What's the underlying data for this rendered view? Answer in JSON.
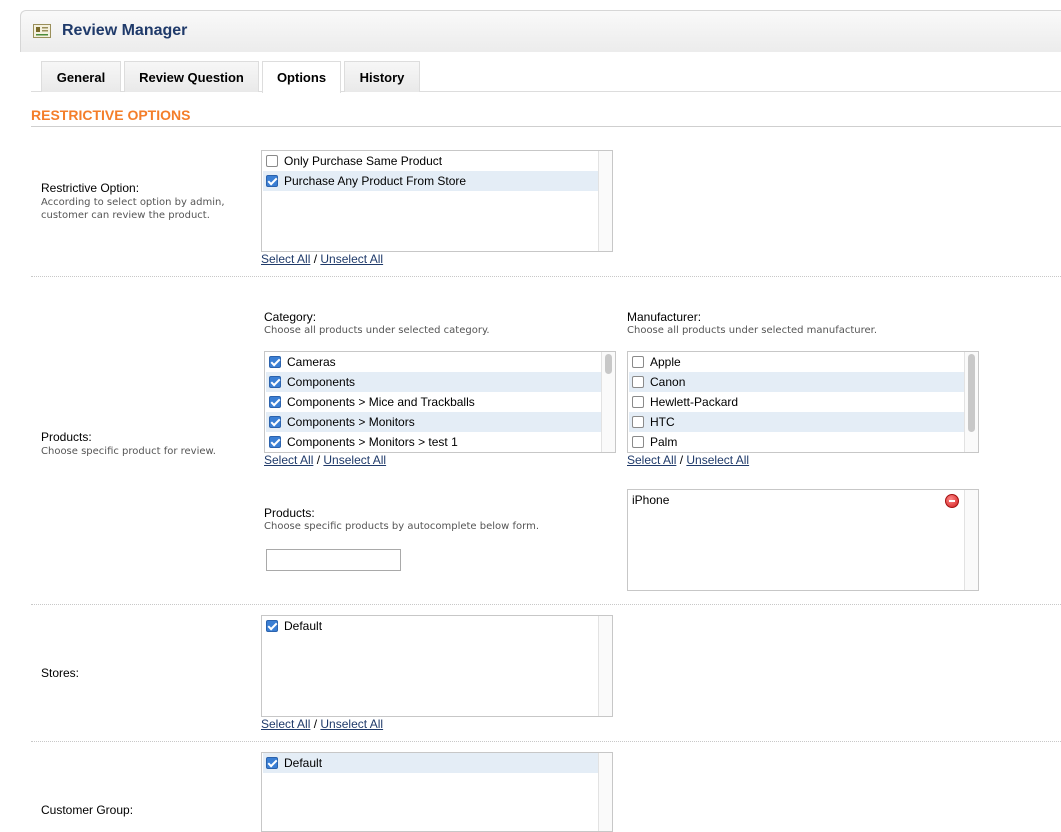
{
  "header": {
    "title": "Review Manager",
    "icon": "module-icon"
  },
  "tabs": [
    {
      "label": "General",
      "active": false
    },
    {
      "label": "Review Question",
      "active": false
    },
    {
      "label": "Options",
      "active": true
    },
    {
      "label": "History",
      "active": false
    }
  ],
  "section_title": "RESTRICTIVE OPTIONS",
  "restrictive": {
    "label": "Restrictive Option:",
    "help": "According to select option by admin, customer can review the product.",
    "options": [
      {
        "label": "Only Purchase Same Product",
        "checked": false
      },
      {
        "label": "Purchase Any Product From Store",
        "checked": true
      }
    ],
    "select_all": "Select All",
    "separator": "/",
    "unselect_all": "Unselect All"
  },
  "products": {
    "label": "Products:",
    "help": "Choose specific product for review.",
    "category": {
      "title": "Category:",
      "help": "Choose all products under selected category.",
      "options": [
        {
          "label": "Cameras",
          "checked": true
        },
        {
          "label": "Components",
          "checked": true
        },
        {
          "label": "Components > Mice and Trackballs",
          "checked": true
        },
        {
          "label": "Components > Monitors",
          "checked": true
        },
        {
          "label": "Components > Monitors > test 1",
          "checked": true
        }
      ],
      "select_all": "Select All",
      "separator": "/",
      "unselect_all": "Unselect All"
    },
    "manufacturer": {
      "title": "Manufacturer:",
      "help": "Choose all products under selected manufacturer.",
      "options": [
        {
          "label": "Apple",
          "checked": false
        },
        {
          "label": "Canon",
          "checked": false
        },
        {
          "label": "Hewlett-Packard",
          "checked": false
        },
        {
          "label": "HTC",
          "checked": false
        },
        {
          "label": "Palm",
          "checked": false
        }
      ],
      "select_all": "Select All",
      "separator": "/",
      "unselect_all": "Unselect All"
    },
    "specific": {
      "title": "Products:",
      "help": "Choose specific products by autocomplete below form.",
      "input_value": "",
      "selected": [
        "iPhone"
      ]
    }
  },
  "stores": {
    "label": "Stores:",
    "options": [
      {
        "label": "Default",
        "checked": true
      }
    ],
    "select_all": "Select All",
    "separator": "/",
    "unselect_all": "Unselect All"
  },
  "customer_group": {
    "label": "Customer Group:",
    "options": [
      {
        "label": "Default",
        "checked": true
      }
    ]
  },
  "colors": {
    "accent": "#f47e2a",
    "title": "#1f3a6a",
    "row_alt": "#e4edf6"
  }
}
